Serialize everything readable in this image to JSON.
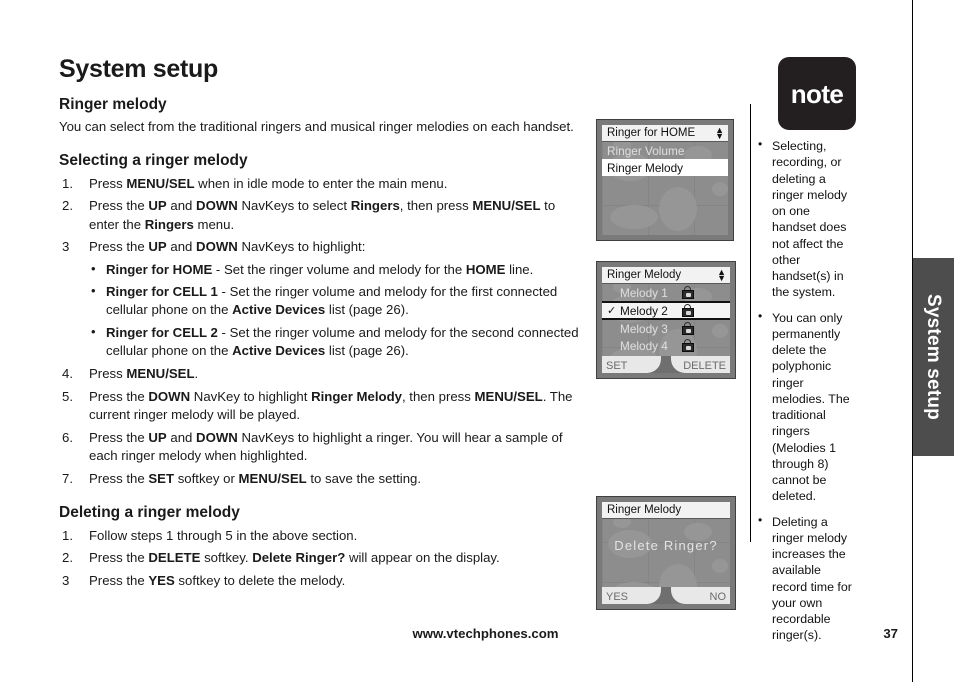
{
  "chapter_tab": {
    "label": "System setup"
  },
  "page": {
    "title": "System setup",
    "footer_url": "www.vtechphones.com",
    "page_number": "37"
  },
  "sections": {
    "ringer_melody": {
      "heading": "Ringer melody",
      "intro": "You can select from the traditional ringers and musical ringer melodies on each handset."
    },
    "selecting": {
      "heading": "Selecting a ringer melody",
      "steps": [
        {
          "num": "1.",
          "text": "Press MENU/SEL when in idle mode to enter the main menu."
        },
        {
          "num": "2.",
          "text": "Press the UP and DOWN NavKeys to select Ringers, then press MENU/SEL to enter the Ringers menu."
        },
        {
          "num": "3",
          "text": "Press the UP and DOWN NavKeys to highlight:"
        },
        {
          "num": "4.",
          "text": "Press MENU/SEL."
        },
        {
          "num": "5.",
          "text": "Press the DOWN NavKey to highlight Ringer Melody, then press MENU/SEL. The current ringer melody will be played."
        },
        {
          "num": "6.",
          "text": "Press the UP and DOWN NavKeys to highlight a ringer. You will hear a sample of each ringer melody when highlighted."
        },
        {
          "num": "7.",
          "text": "Press the SET softkey or MENU/SEL to save the setting."
        }
      ],
      "bullets": [
        "Ringer for HOME - Set the ringer volume and melody for the HOME line.",
        "Ringer for CELL 1 - Set the ringer volume and melody for the first connected cellular phone on the Active Devices list (page 26).",
        "Ringer for CELL 2 - Set the ringer volume and melody for the second connected cellular phone on the Active Devices list (page 26)."
      ]
    },
    "deleting": {
      "heading": "Deleting a ringer melody",
      "steps": [
        {
          "num": "1.",
          "text": "Follow steps 1 through 5 in the above section."
        },
        {
          "num": "2.",
          "text": "Press the DELETE softkey. Delete Ringer? will appear on the display."
        },
        {
          "num": "3",
          "text": "Press the YES softkey to delete the melody."
        }
      ]
    }
  },
  "note": {
    "badge_label": "note",
    "items": [
      "Selecting, recording, or deleting a ringer melody on one handset does not affect the other handset(s) in the system.",
      "You can only permanently delete the polyphonic ringer melodies. The traditional ringers (Melodies 1 through 8) cannot be deleted.",
      "Deleting a ringer melody increases the available record time for your own recordable ringer(s)."
    ]
  },
  "screens": {
    "screen1": {
      "title": "Ringer for HOME",
      "rows": [
        {
          "label": "Ringer Volume",
          "state": "dim"
        },
        {
          "label": "Ringer Melody",
          "state": "selected"
        }
      ]
    },
    "screen2": {
      "title": "Ringer Melody",
      "rows": [
        {
          "label": "Melody 1",
          "state": "dim",
          "lock": true,
          "check": ""
        },
        {
          "label": "Melody 2",
          "state": "boxed",
          "lock": true,
          "check": "✓"
        },
        {
          "label": "Melody 3",
          "state": "dim",
          "lock": true,
          "check": ""
        },
        {
          "label": "Melody 4",
          "state": "dim",
          "lock": true,
          "check": ""
        }
      ],
      "softkey_left": "SET",
      "softkey_right": "DELETE"
    },
    "screen3": {
      "title": "Ringer Melody",
      "dialog_text": "Delete Ringer?",
      "softkey_left": "YES",
      "softkey_right": "NO"
    }
  }
}
